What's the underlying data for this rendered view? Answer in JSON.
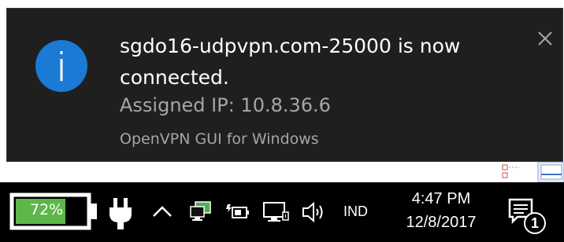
{
  "notification": {
    "title": "sgdo16-udpvpn.com-25000 is now connected.",
    "body": "Assigned IP: 10.8.36.6",
    "attribution": "OpenVPN GUI for Windows",
    "icon": "info-icon",
    "close_icon": "close-icon"
  },
  "taskbar": {
    "battery_percent": "72%",
    "battery_level": 0.72,
    "language": "IND",
    "time": "4:47 PM",
    "date": "12/8/2017",
    "notification_count": "1",
    "icons": [
      "battery-icon",
      "power-plug-icon",
      "chevron-up-icon",
      "network-adapter-icon",
      "battery-status-icon",
      "network-icon",
      "speaker-icon",
      "action-center-icon"
    ]
  },
  "colors": {
    "toast_bg": "#1f1f1f",
    "info_blue": "#1a7ad4",
    "battery_green": "#5fb64a",
    "taskbar_bg": "#000000"
  }
}
